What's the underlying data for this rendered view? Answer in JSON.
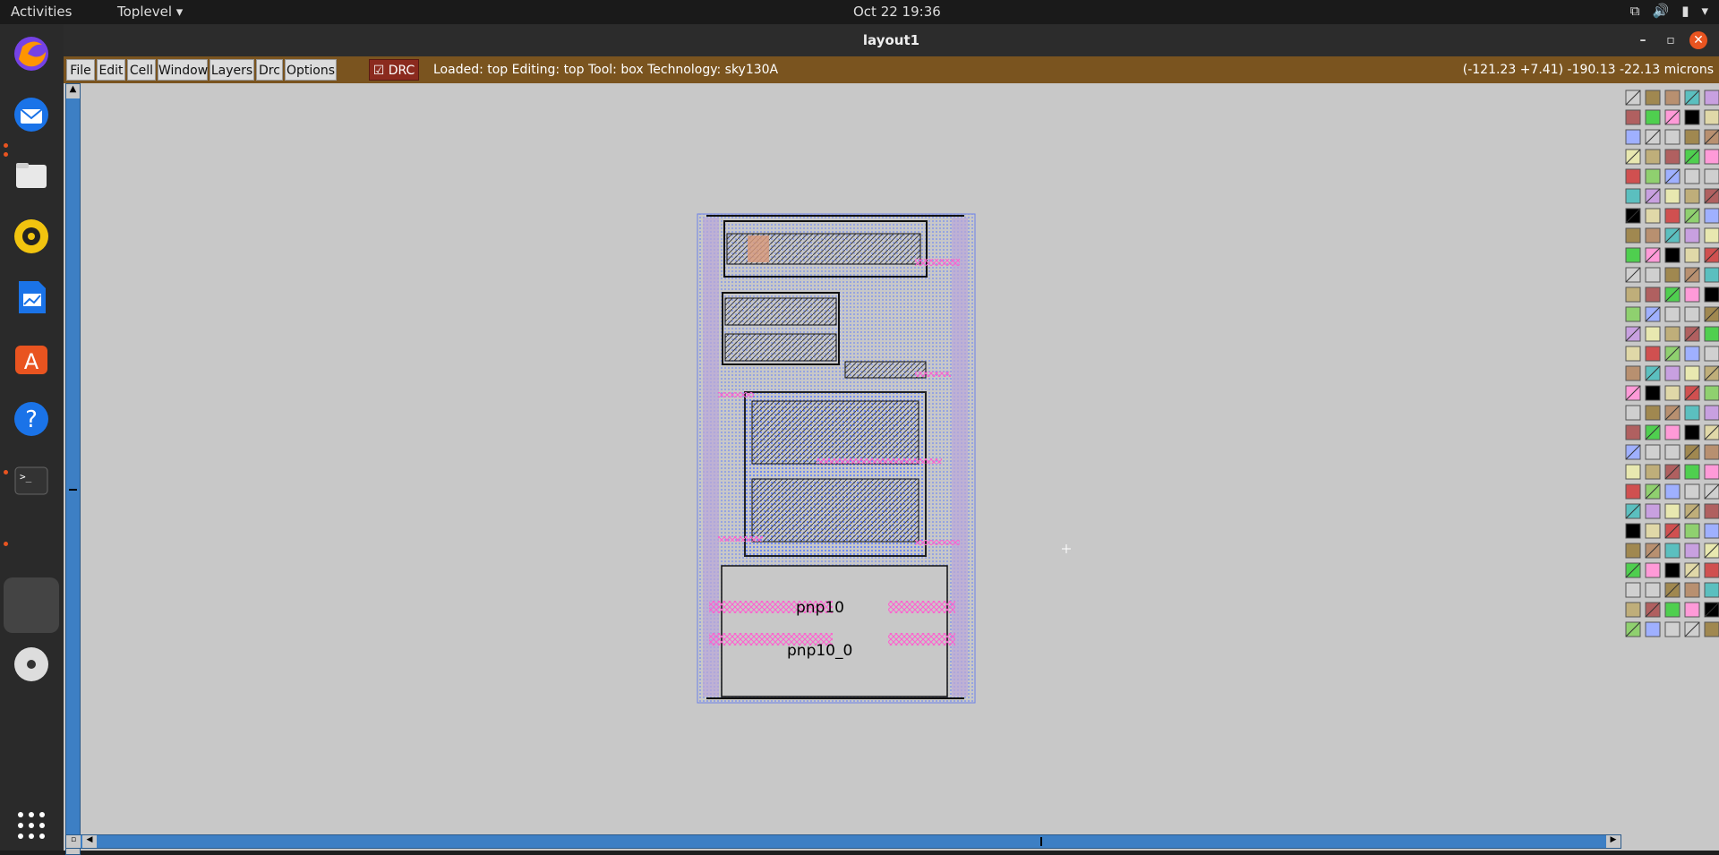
{
  "topbar": {
    "activities": "Activities",
    "app_menu": "Toplevel",
    "clock": "Oct 22  19:36"
  },
  "window": {
    "title": "layout1",
    "menus": [
      "File",
      "Edit",
      "Cell",
      "Window",
      "Layers",
      "Drc",
      "Options"
    ],
    "drc_label": "DRC",
    "status": "Loaded: top Editing: top Tool: box  Technology: sky130A",
    "coords": "(-121.23 +7.41) -190.13 -22.13 microns"
  },
  "layout": {
    "cell_labels": [
      "pnp10",
      "pnp10_0"
    ]
  },
  "colors": {
    "menubar": "#7a541f",
    "canvas": "#c8c8c8",
    "scrollbar": "#3d7fc4"
  }
}
